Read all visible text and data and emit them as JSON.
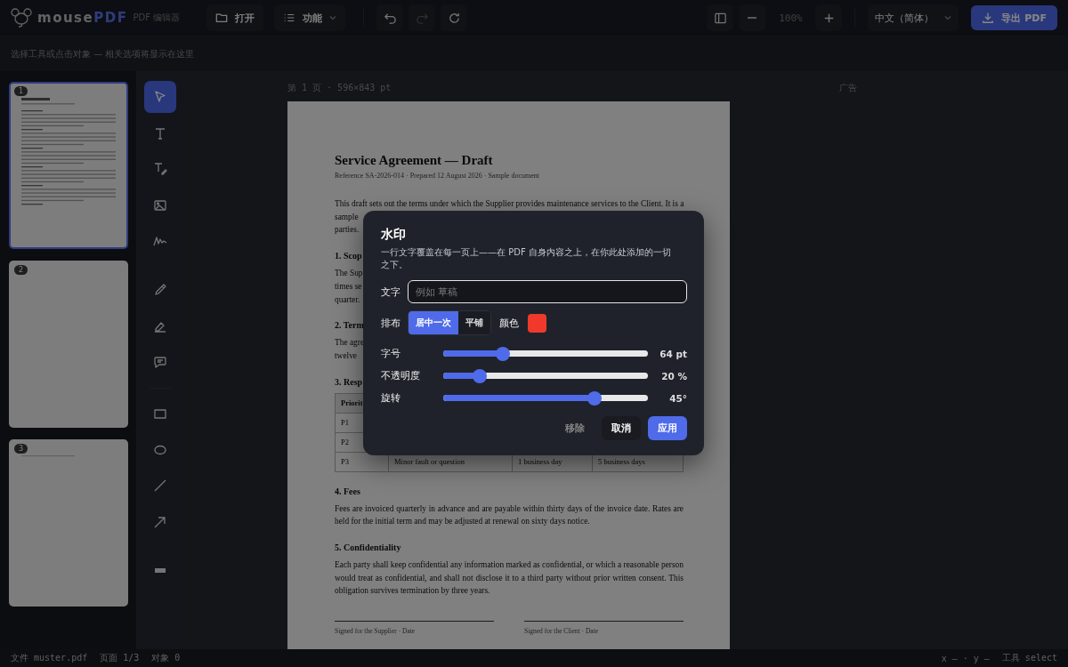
{
  "app": {
    "logo_prefix": "mouse",
    "logo_accent": "PDF",
    "subtitle": "PDF 编辑器"
  },
  "toolbar": {
    "open": "打开",
    "features": "功能",
    "undo_disabled": false,
    "redo_disabled": true,
    "zoom": "100%",
    "language": "中文（简体）",
    "export": "导出 PDF"
  },
  "hint": "选择工具或点击对象 — 相关选项将显示在这里",
  "thumbnails": [
    {
      "number": "1",
      "selected": true,
      "kind": "text"
    },
    {
      "number": "2",
      "selected": false,
      "kind": "blank"
    },
    {
      "number": "3",
      "selected": false,
      "kind": "line"
    }
  ],
  "tools": [
    {
      "kind": "select",
      "selected": true
    },
    {
      "kind": "text",
      "selected": false
    },
    {
      "kind": "edit-text",
      "selected": false
    },
    {
      "kind": "image",
      "selected": false
    },
    {
      "kind": "signature",
      "selected": false
    },
    {
      "kind": "gap"
    },
    {
      "kind": "pencil",
      "selected": false
    },
    {
      "kind": "highlighter",
      "selected": false
    },
    {
      "kind": "comment",
      "selected": false
    },
    {
      "kind": "divider"
    },
    {
      "kind": "rectangle",
      "selected": false
    },
    {
      "kind": "ellipse",
      "selected": false
    },
    {
      "kind": "line",
      "selected": false
    },
    {
      "kind": "arrow",
      "selected": false
    },
    {
      "kind": "gap"
    },
    {
      "kind": "redact",
      "selected": false
    }
  ],
  "page_label": "第 1 页 · 596×843 pt",
  "ad_label": "广告",
  "document": {
    "title": "Service Agreement — Draft",
    "subtitle": "Reference SA-2026-014 · Prepared 12 August 2026 · Sample document",
    "blocks": [
      {
        "kind": "lines",
        "lines": [
          "This draft sets out the terms under which the Supplier provides maintenance services to the Client. It is a",
          "sample",
          "parties."
        ]
      },
      {
        "kind": "heading",
        "text": "1. Scop"
      },
      {
        "kind": "lines",
        "lines": [
          "The Sup",
          "times se",
          "quarter."
        ]
      },
      {
        "kind": "heading",
        "text": "2. Term"
      },
      {
        "kind": "lines",
        "lines": [
          "The agre",
          "twelve"
        ]
      },
      {
        "kind": "heading",
        "text": "3. Resp"
      },
      {
        "kind": "table",
        "rows": [
          {
            "header": true,
            "cells": [
              "Priorit"
            ]
          },
          {
            "header": false,
            "cells": [
              "P1"
            ]
          },
          {
            "header": false,
            "cells": [
              "P2"
            ]
          },
          {
            "header": false,
            "cells": [
              "P3",
              "Minor fault or question",
              "1 business day",
              "5 business days"
            ]
          }
        ]
      },
      {
        "kind": "heading",
        "text": "4. Fees"
      },
      {
        "kind": "paragraph",
        "text": "Fees are invoiced quarterly in advance and are payable within thirty days of the invoice date. Rates are held for the initial term and may be adjusted at renewal on sixty days notice."
      },
      {
        "kind": "heading",
        "text": "5. Confidentiality"
      },
      {
        "kind": "paragraph",
        "text": "Each party shall keep confidential any information marked as confidential, or which a reasonable person would treat as confidential, and shall not disclose it to a third party without prior written consent. This obligation survives termination by three years."
      },
      {
        "kind": "signatures",
        "items": [
          "Signed for the Supplier · Date",
          "Signed for the Client · Date"
        ]
      }
    ]
  },
  "dialog": {
    "title": "水印",
    "description": "一行文字覆盖在每一页上——在 PDF 自身内容之上，在你此处添加的一切之下。",
    "text_label": "文字",
    "text_placeholder": "例如 草稿",
    "layout_label": "排布",
    "layout_options": [
      {
        "label": "居中一次",
        "selected": true
      },
      {
        "label": "平铺",
        "selected": false
      }
    ],
    "color_label": "颜色",
    "color": "#f0392b",
    "sliders": [
      {
        "label": "字号",
        "level": 0.29,
        "reading": "64 pt"
      },
      {
        "label": "不透明度",
        "level": 0.18,
        "reading": "20 %"
      },
      {
        "label": "旋转",
        "level": 0.74,
        "reading": "45°"
      }
    ],
    "buttons": [
      {
        "label": "移除",
        "kind": "ghost"
      },
      {
        "label": "取消",
        "kind": "secondary"
      },
      {
        "label": "应用",
        "kind": "primary"
      }
    ]
  },
  "status_bar": {
    "file": "文件 muster.pdf",
    "page": "页面 1/3",
    "objects": "对象 0",
    "coords": "x — · y —",
    "tool": "工具 select"
  }
}
